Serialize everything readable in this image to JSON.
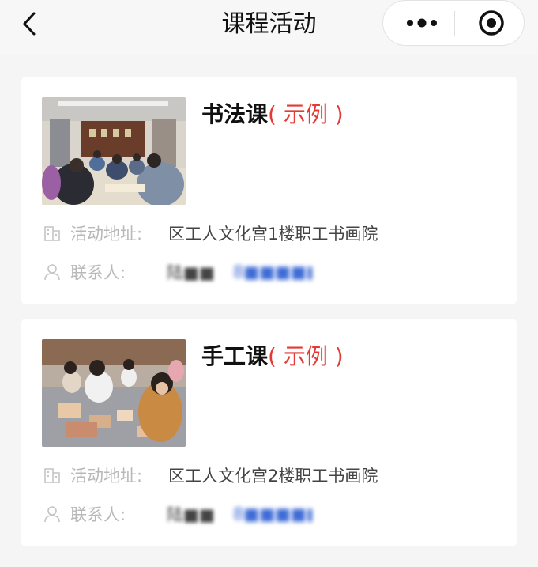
{
  "nav": {
    "title": "课程活动"
  },
  "icons": {
    "back": "chevron-left-icon",
    "more": "more-dots-icon",
    "close": "target-icon",
    "address": "building-icon",
    "contact": "person-icon"
  },
  "colors": {
    "example_tag": "#e53935",
    "phone_link": "#3e6bd6",
    "label": "#b8b8b8"
  },
  "activities": [
    {
      "title": "书法课",
      "tag": "( 示例 )",
      "address_label": "活动地址:",
      "address": "区工人文化宫1楼职工书画院",
      "contact_label": "联系人:",
      "contact_name": "陆■■",
      "contact_phone": "8■■■■■",
      "image": "calligraphy-class-photo"
    },
    {
      "title": "手工课",
      "tag": "( 示例 )",
      "address_label": "活动地址:",
      "address": "区工人文化宫2楼职工书画院",
      "contact_label": "联系人:",
      "contact_name": "陆■■",
      "contact_phone": "8■■■■■",
      "image": "handcraft-class-photo"
    }
  ]
}
